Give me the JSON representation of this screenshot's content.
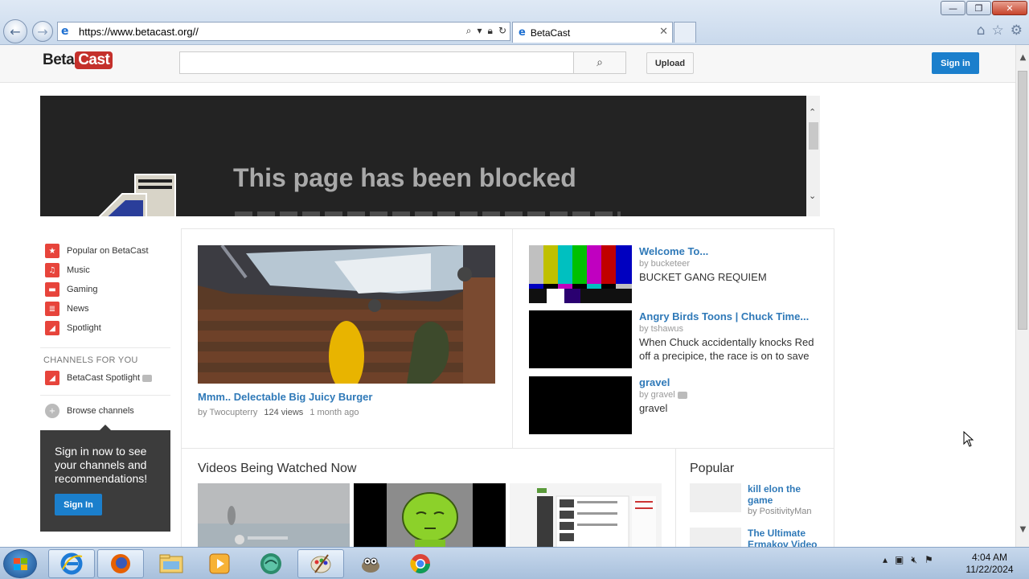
{
  "browser": {
    "url": "https://www.betacast.org//",
    "tab_title": "BetaCast",
    "window_buttons": {
      "minimize": "—",
      "maximize": "❐",
      "close": "✕"
    }
  },
  "site": {
    "logo_part1": "Beta",
    "logo_part2": "Cast",
    "search_placeholder": "",
    "upload_label": "Upload",
    "signin_label": "Sign in"
  },
  "blocked": {
    "message": "This page has been blocked"
  },
  "guide": {
    "items": [
      {
        "label": "Popular on BetaCast",
        "icon": "star-icon"
      },
      {
        "label": "Music",
        "icon": "headphones-icon"
      },
      {
        "label": "Gaming",
        "icon": "gamepad-icon"
      },
      {
        "label": "News",
        "icon": "newspaper-icon"
      },
      {
        "label": "Spotlight",
        "icon": "spotlight-icon"
      }
    ],
    "channels_heading": "CHANNELS FOR YOU",
    "channel": "BetaCast Spotlight",
    "browse": "Browse channels",
    "prompt_text": "Sign in now to see your channels and recommendations!",
    "prompt_button": "Sign In"
  },
  "featured": {
    "title": "Mmm.. Delectable Big Juicy Burger",
    "by": "by Twocupterry",
    "views": "124 views",
    "ago": "1 month ago"
  },
  "side_videos": [
    {
      "title": "Welcome To...",
      "by": "by bucketeer",
      "desc": "BUCKET GANG REQUIEM"
    },
    {
      "title": "Angry Birds Toons | Chuck Time...",
      "by": "by tshawus",
      "desc": "When Chuck accidentally knocks Red off a precipice, the race is on to save"
    },
    {
      "title": "gravel",
      "by": "by gravel",
      "desc": "gravel"
    }
  ],
  "watching": {
    "title": "Videos Being Watched Now"
  },
  "popular": {
    "title": "Popular",
    "items": [
      {
        "title": "kill elon the game",
        "by": "by PositivityMan"
      },
      {
        "title": "The Ultimate Ermakov Video",
        "by": ""
      }
    ]
  },
  "taskbar": {
    "time": "4:04 AM",
    "date": "11/22/2024"
  }
}
